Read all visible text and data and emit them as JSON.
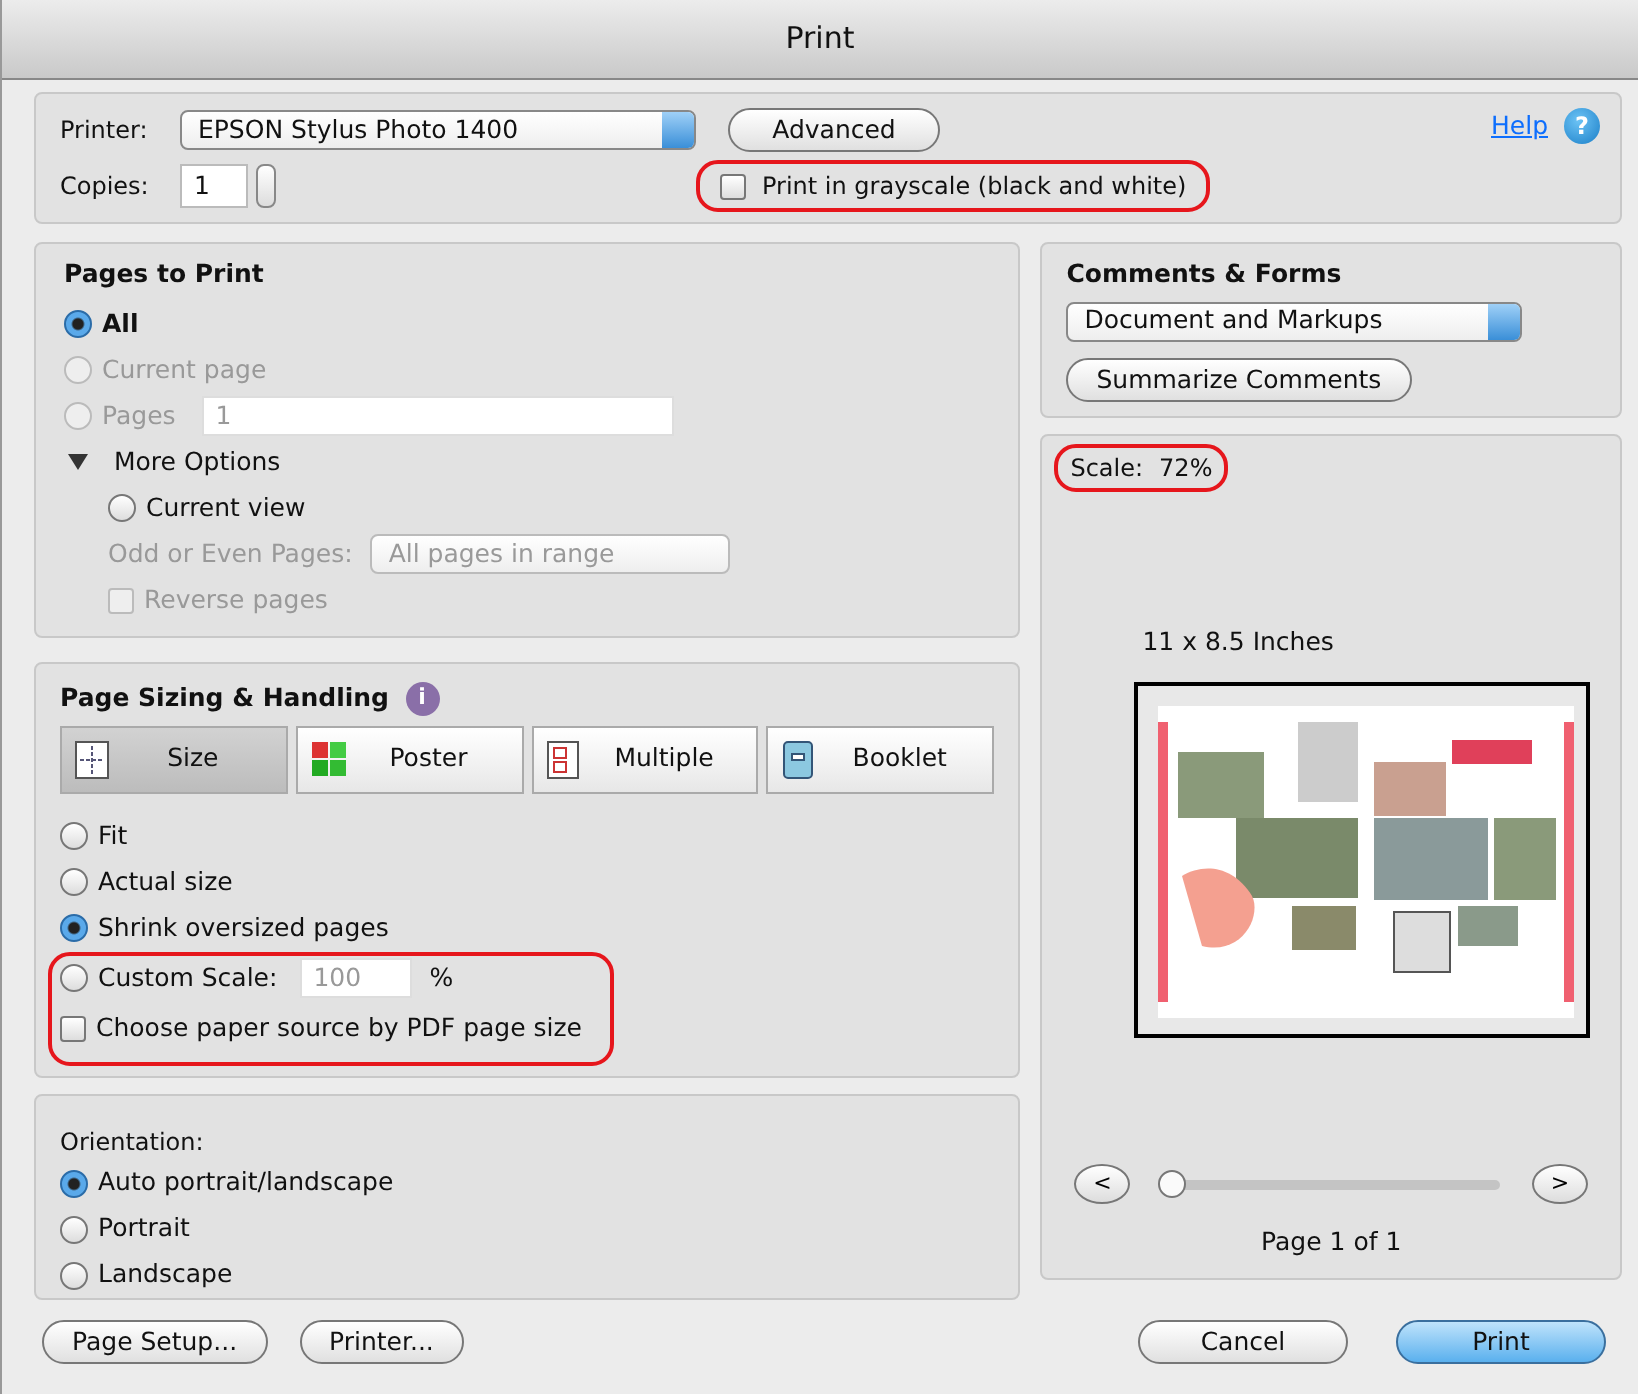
{
  "window": {
    "title": "Print"
  },
  "printer": {
    "label": "Printer:",
    "value": "EPSON Stylus Photo 1400"
  },
  "advanced_button": "Advanced",
  "help": {
    "link": "Help",
    "icon": "?"
  },
  "copies": {
    "label": "Copies:",
    "value": "1"
  },
  "grayscale": {
    "label": "Print in grayscale (black and white)",
    "checked": false,
    "highlighted": true
  },
  "pages_to_print": {
    "title": "Pages to Print",
    "options": [
      {
        "label": "All",
        "selected": true,
        "disabled": false
      },
      {
        "label": "Current page",
        "selected": false,
        "disabled": true
      },
      {
        "label": "Pages",
        "selected": false,
        "disabled": true,
        "field": "1"
      }
    ],
    "more_options": {
      "label": "More Options",
      "expanded": true,
      "current_view": {
        "label": "Current view",
        "selected": false
      },
      "odd_even": {
        "label": "Odd or Even Pages:",
        "value": "All pages in range",
        "disabled": true
      },
      "reverse": {
        "label": "Reverse pages",
        "checked": false,
        "disabled": true
      }
    }
  },
  "page_sizing": {
    "title": "Page Sizing & Handling",
    "info_icon": "i",
    "tabs": [
      {
        "label": "Size",
        "kind": "size",
        "selected": true
      },
      {
        "label": "Poster",
        "kind": "poster",
        "selected": false
      },
      {
        "label": "Multiple",
        "kind": "multiple",
        "selected": false
      },
      {
        "label": "Booklet",
        "kind": "booklet",
        "selected": false
      }
    ],
    "options": [
      {
        "label": "Fit",
        "selected": false
      },
      {
        "label": "Actual size",
        "selected": false
      },
      {
        "label": "Shrink oversized pages",
        "selected": true
      }
    ],
    "custom_scale": {
      "label": "Custom Scale:",
      "selected": false,
      "field": "100",
      "unit": "%"
    },
    "paper_source": {
      "label": "Choose paper source by PDF page size",
      "checked": false
    },
    "highlighted": true
  },
  "orientation": {
    "title": "Orientation:",
    "options": [
      {
        "label": "Auto portrait/landscape",
        "selected": true
      },
      {
        "label": "Portrait",
        "selected": false
      },
      {
        "label": "Landscape",
        "selected": false
      }
    ]
  },
  "comments_forms": {
    "title": "Comments & Forms",
    "value": "Document and Markups",
    "button": "Summarize Comments"
  },
  "preview": {
    "scale_label": "Scale:",
    "scale_value": "72%",
    "scale_highlighted": true,
    "paper_size": "11 x 8.5 Inches",
    "prev": "<",
    "next": ">",
    "slider": {
      "level": 0
    },
    "page": "Page 1 of 1"
  },
  "buttons_left": [
    "Page Setup...",
    "Printer..."
  ],
  "buttons_right": [
    {
      "label": "Cancel",
      "kind": "default"
    },
    {
      "label": "Print",
      "kind": "primary"
    }
  ]
}
